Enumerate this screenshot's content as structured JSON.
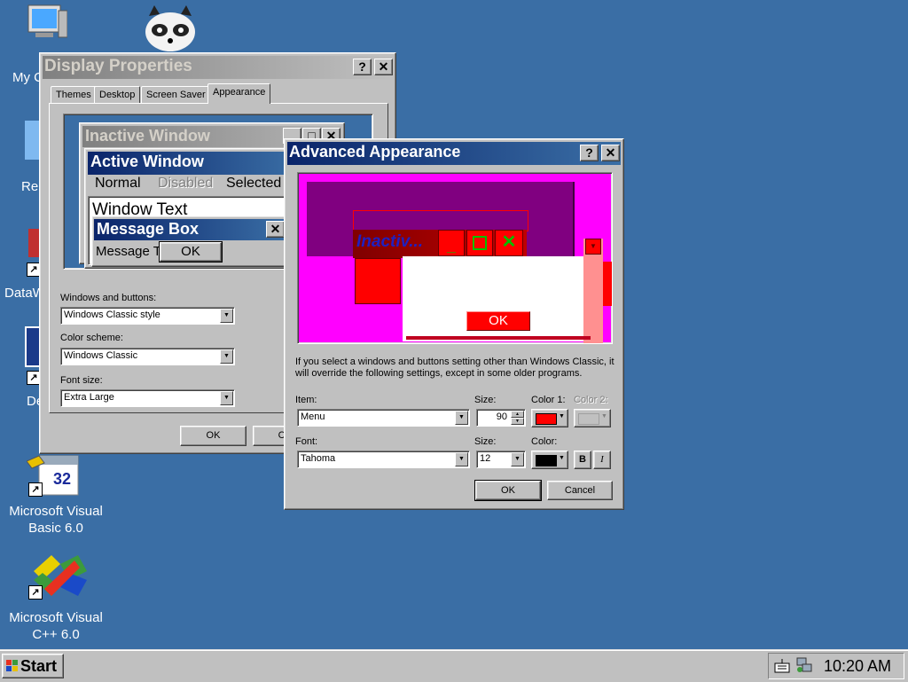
{
  "desktop": {
    "icons": [
      {
        "label": "My C",
        "icon": "computer-icon"
      },
      {
        "label": "",
        "icon": "raccoon-icon"
      },
      {
        "label": "Re",
        "icon": "recycle-bin-icon"
      },
      {
        "label": "DataW",
        "icon": "datawindow-icon"
      },
      {
        "label": "De",
        "icon": "de-icon"
      },
      {
        "label": "Microsoft Visual Basic 6.0",
        "icon": "vb6-icon",
        "badge": "32"
      },
      {
        "label": "Microsoft Visual C++ 6.0",
        "icon": "vcpp-icon"
      }
    ]
  },
  "display_properties": {
    "title": "Display Properties",
    "tabs": [
      "Themes",
      "Desktop",
      "Screen Saver",
      "Appearance"
    ],
    "active_tab": "Appearance",
    "preview": {
      "inactive_title": "Inactive Window",
      "active_title": "Active Window",
      "menu_normal": "Normal",
      "menu_disabled": "Disabled",
      "menu_selected": "Selected",
      "window_text": "Window Text",
      "message_box_title": "Message Box",
      "message_text": "Message T",
      "ok": "OK"
    },
    "windows_buttons_label": "Windows and buttons:",
    "windows_buttons_value": "Windows Classic style",
    "color_scheme_label": "Color scheme:",
    "color_scheme_value": "Windows Classic",
    "font_size_label": "Font size:",
    "font_size_value": "Extra Large",
    "ok": "OK",
    "cancel": "Car"
  },
  "advanced": {
    "title": "Advanced Appearance",
    "preview": {
      "inactive_title": "Inactiv...",
      "ok": "OK"
    },
    "notice": "If you select a windows and buttons setting other than Windows Classic, it will override the following settings, except in some older programs.",
    "item_label": "Item:",
    "item_value": "Menu",
    "size_label": "Size:",
    "size_value": "90",
    "color1_label": "Color 1:",
    "color2_label": "Color 2:",
    "font_label": "Font:",
    "font_value": "Tahoma",
    "font_size_label": "Size:",
    "font_size_value": "12",
    "color_label": "Color:",
    "bold": "B",
    "italic": "I",
    "ok": "OK",
    "cancel": "Cancel"
  },
  "taskbar": {
    "start": "Start",
    "clock": "10:20 AM"
  },
  "colors": {
    "desktop": "#3a6ea5",
    "active_title": "#0a246a",
    "inactive_title": "#808080",
    "magenta": "#ff00ff",
    "purple": "#800080",
    "red": "#ff0000"
  }
}
